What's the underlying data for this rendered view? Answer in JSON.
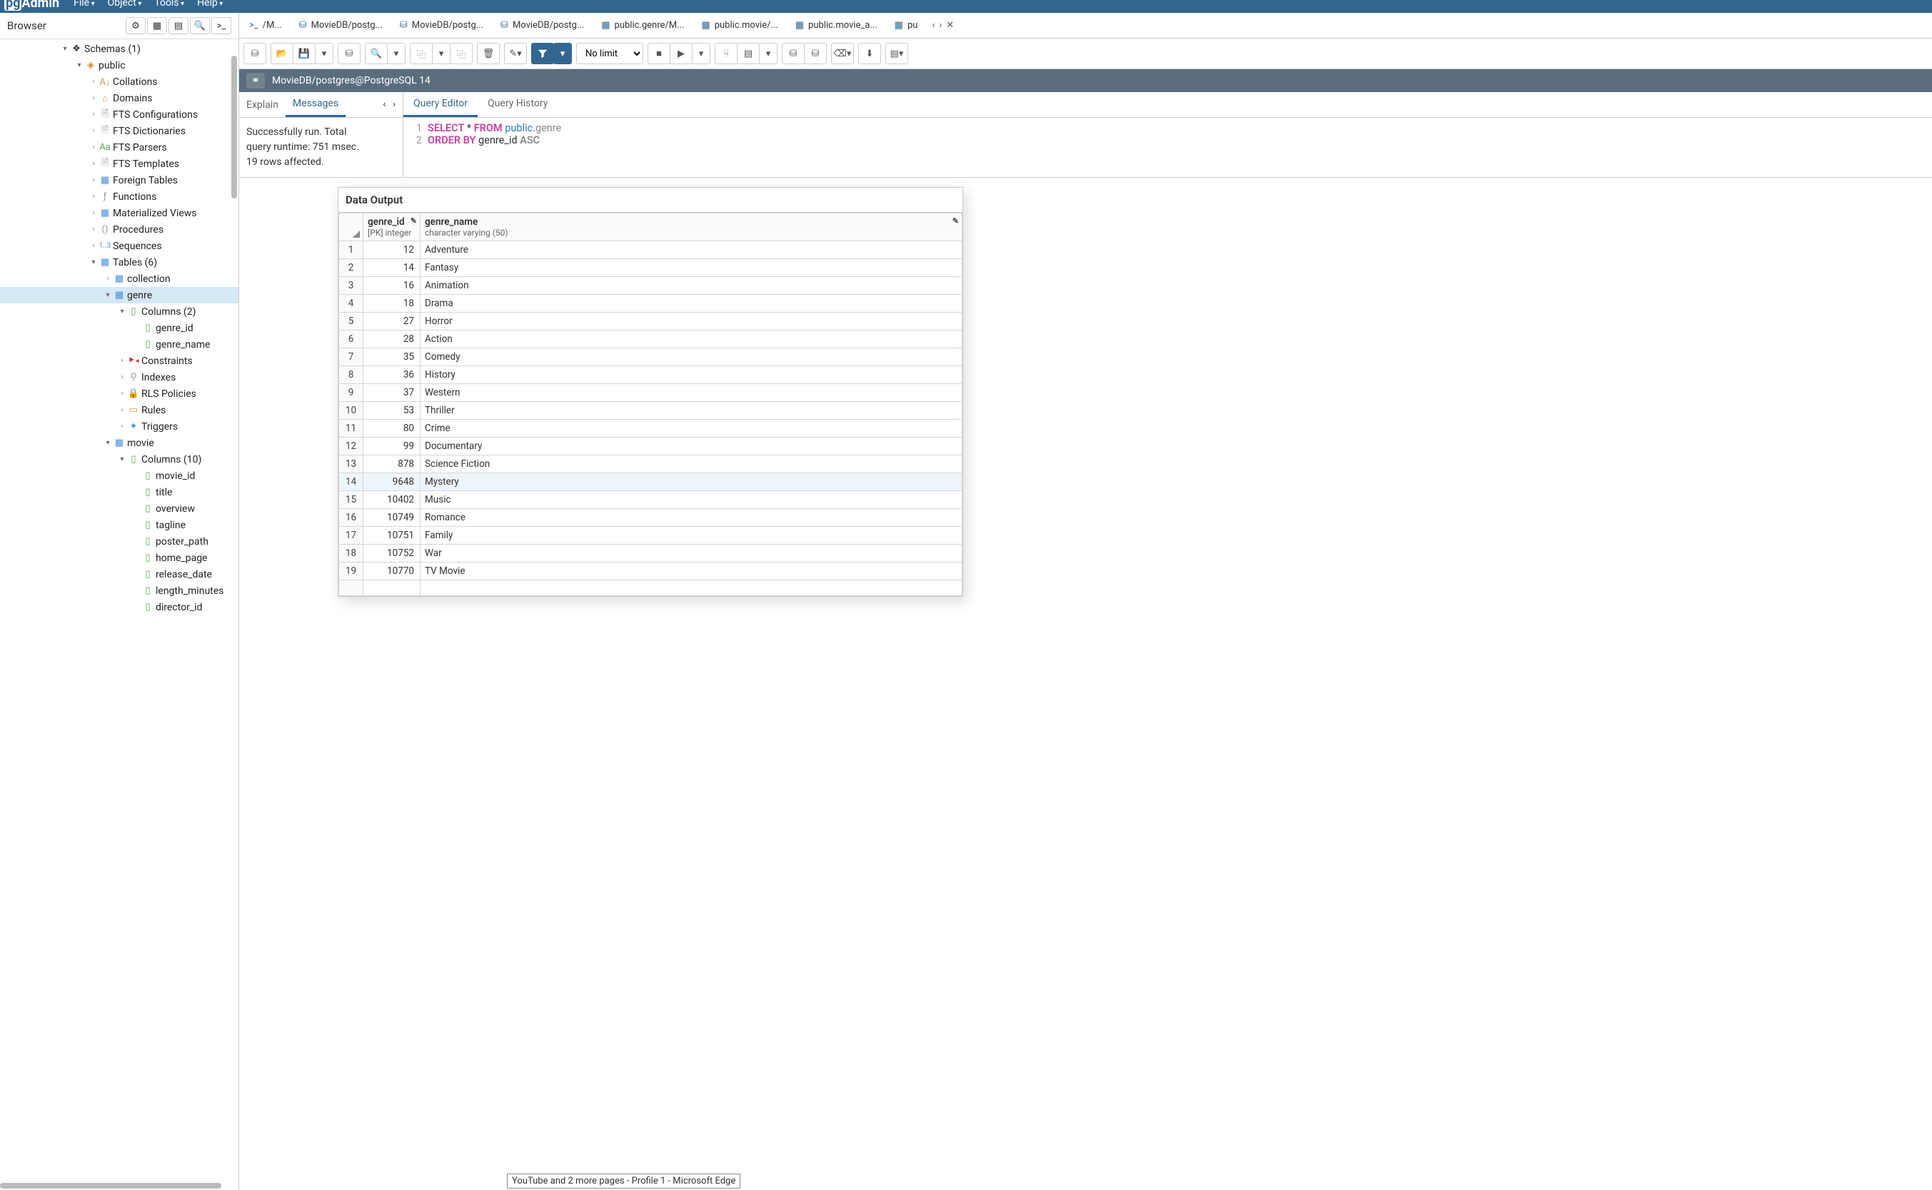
{
  "topbar": {
    "logo_pg": "pg",
    "logo_admin": "Admin",
    "menus": [
      "File",
      "Object",
      "Tools",
      "Help"
    ]
  },
  "sidebar": {
    "title": "Browser",
    "tree": {
      "schemas": "Schemas (1)",
      "public": "public",
      "collations": "Collations",
      "domains": "Domains",
      "fts_conf": "FTS Configurations",
      "fts_dict": "FTS Dictionaries",
      "fts_parsers": "FTS Parsers",
      "fts_templates": "FTS Templates",
      "foreign_tables": "Foreign Tables",
      "functions": "Functions",
      "mat_views": "Materialized Views",
      "procedures": "Procedures",
      "sequences": "Sequences",
      "tables": "Tables (6)",
      "collection": "collection",
      "genre": "genre",
      "genre_columns": "Columns (2)",
      "genre_id": "genre_id",
      "genre_name": "genre_name",
      "constraints": "Constraints",
      "indexes": "Indexes",
      "rls": "RLS Policies",
      "rules": "Rules",
      "triggers": "Triggers",
      "movie": "movie",
      "movie_columns": "Columns (10)",
      "movie_id": "movie_id",
      "title_col": "title",
      "overview": "overview",
      "tagline": "tagline",
      "poster_path": "poster_path",
      "home_page": "home_page",
      "release_date": "release_date",
      "length_minutes": "length_minutes",
      "director_id": "director_id"
    }
  },
  "tabs": {
    "t0": "/M...",
    "t1": "MovieDB/postg...",
    "t2": "MovieDB/postg...",
    "t3": "MovieDB/postg...",
    "t4": "public.genre/M...",
    "t5": "public.movie/...",
    "t6": "public.movie_a...",
    "t7": "pu"
  },
  "toolbar": {
    "limit": "No limit"
  },
  "connbar": {
    "conn": "MovieDB/postgres@PostgreSQL 14"
  },
  "msgtabs": {
    "explain": "Explain",
    "messages": "Messages"
  },
  "message": {
    "l1": "Successfully run. Total",
    "l2": "query runtime: 751 msec.",
    "l3": "19 rows affected."
  },
  "qtabs": {
    "editor": "Query Editor",
    "history": "Query History"
  },
  "query": {
    "ln1": "1",
    "ln2": "2",
    "select": "SELECT",
    "star": "*",
    "from": "FROM",
    "schema": "public",
    "dot": ".",
    "table": "genre",
    "orderby": "ORDER BY",
    "col": "genre_id",
    "asc": "ASC"
  },
  "dataoutput": {
    "title": "Data Output",
    "col1_name": "genre_id",
    "col1_type": "[PK] integer",
    "col2_name": "genre_name",
    "col2_type": "character varying (50)",
    "rows": [
      {
        "n": 1,
        "id": 12,
        "name": "Adventure"
      },
      {
        "n": 2,
        "id": 14,
        "name": "Fantasy"
      },
      {
        "n": 3,
        "id": 16,
        "name": "Animation"
      },
      {
        "n": 4,
        "id": 18,
        "name": "Drama"
      },
      {
        "n": 5,
        "id": 27,
        "name": "Horror"
      },
      {
        "n": 6,
        "id": 28,
        "name": "Action"
      },
      {
        "n": 7,
        "id": 35,
        "name": "Comedy"
      },
      {
        "n": 8,
        "id": 36,
        "name": "History"
      },
      {
        "n": 9,
        "id": 37,
        "name": "Western"
      },
      {
        "n": 10,
        "id": 53,
        "name": "Thriller"
      },
      {
        "n": 11,
        "id": 80,
        "name": "Crime"
      },
      {
        "n": 12,
        "id": 99,
        "name": "Documentary"
      },
      {
        "n": 13,
        "id": 878,
        "name": "Science Fiction"
      },
      {
        "n": 14,
        "id": 9648,
        "name": "Mystery"
      },
      {
        "n": 15,
        "id": 10402,
        "name": "Music"
      },
      {
        "n": 16,
        "id": 10749,
        "name": "Romance"
      },
      {
        "n": 17,
        "id": 10751,
        "name": "Family"
      },
      {
        "n": 18,
        "id": 10752,
        "name": "War"
      },
      {
        "n": 19,
        "id": 10770,
        "name": "TV Movie"
      }
    ]
  },
  "taskbar_tip": "YouTube and 2 more pages - Profile 1 - Microsoft Edge"
}
